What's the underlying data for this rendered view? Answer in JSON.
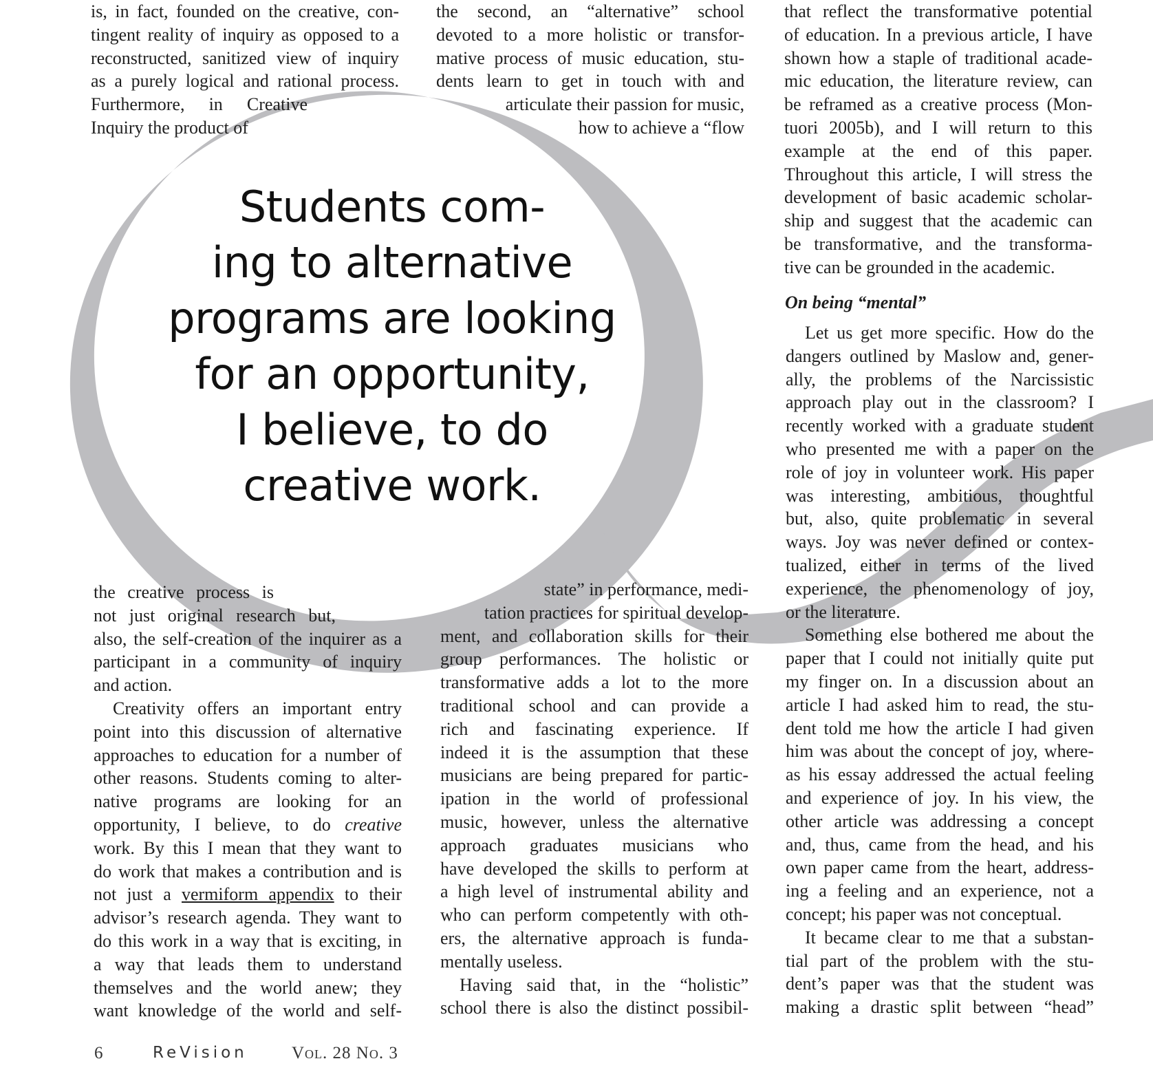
{
  "col1_top": [
    "is, in fact, founded on the creative, con-",
    "tingent reality of inquiry as opposed to a",
    "reconstructed, sanitized view of inquiry",
    "as a purely logical and rational process.",
    "Furthermore,  in  Creative",
    "Inquiry the product of"
  ],
  "col2_top": [
    "the second, an “alternative” school",
    "devoted to a more holistic or transfor-",
    "mative process of music education, stu-",
    "dents learn to get in touch with and",
    "articulate their passion for music,",
    "how to achieve a “flow"
  ],
  "col3": {
    "para1": [
      "that reflect the transformative potential",
      "of education. In a previous article, I have",
      "shown how a staple of traditional acade-",
      "mic education, the literature review, can",
      "be reframed as a creative process (Mon-",
      "tuori 2005b), and I will return to this",
      "example at the end of this paper.",
      "Throughout this article, I will stress the",
      "development of basic academic scholar-",
      "ship and suggest that the academic can",
      "be transformative, and the transforma-",
      "tive can be grounded in the academic."
    ],
    "heading": "On being “mental”",
    "para2": [
      "Let us get more specific. How do the",
      "dangers outlined by Maslow and, gener-",
      "ally, the problems of the Narcissistic",
      "approach play out in the classroom? I",
      "recently worked with a graduate student",
      "who presented me with a paper on the",
      "role of joy in volunteer work. His paper",
      "was interesting, ambitious, thoughtful",
      "but, also, quite problematic in several",
      "ways. Joy was never defined or contex-",
      "tualized, either in terms of the lived",
      "experience, the phenomenology of joy,",
      "or the literature."
    ],
    "para3": [
      "Something else bothered me about the",
      "paper that I could not initially quite put",
      "my finger on. In a discussion about an",
      "article I had asked him to read, the stu-",
      "dent told me how the article I had given",
      "him was about the concept of joy, where-",
      "as his essay addressed the actual feeling",
      "and experience of joy. In his view, the",
      "other article was addressing a concept",
      "and, thus, came from the head, and his",
      "own paper came from the heart, address-",
      "ing a feeling and an experience, not a",
      "concept; his paper was not conceptual."
    ],
    "para4": [
      "It became clear to me that a substan-",
      "tial part of the problem with the stu-",
      "dent’s paper was that the student was",
      "making a drastic split between “head”"
    ]
  },
  "col1_bottom": {
    "para1": [
      "the creative process is",
      "not just original research but,",
      "also, the self-creation of the inquirer as a",
      "participant in a community of inquiry",
      "and action."
    ],
    "para2": {
      "l1": "Creativity offers an important entry",
      "l2": "point into this discussion of alternative",
      "l3": "approaches to education for a number of",
      "l4": "other reasons. Students coming to alter-",
      "l5": "native programs are looking for an",
      "l6a": "opportunity, I believe, to do ",
      "l6b": "creative",
      "l7": "work. By this I mean that they want to",
      "l8": "do work that makes a contribution and is",
      "l9a": "not just a ",
      "l9b": "vermiform appendix",
      "l9c": " to their",
      "l10": "advisor’s research agenda. They want to",
      "l11": "do this work in a way that is exciting, in",
      "l12": "a way that leads them to understand",
      "l13": "themselves and the world anew; they",
      "l14": "want knowledge of the world and self-"
    }
  },
  "col2_bottom": {
    "para1": [
      "state” in performance, medi-",
      "tation practices for spiritual develop-",
      "ment, and collaboration skills for their",
      "group performances. The holistic or",
      "transformative adds a lot to the more",
      "traditional school and can provide a",
      "rich and fascinating experience. If",
      "indeed it is the assumption that these",
      "musicians are being prepared for partic-",
      "ipation in the world of professional",
      "music, however, unless the alternative",
      "approach graduates musicians who",
      "have developed the skills to perform at",
      "a high level of instrumental ability and",
      "who can perform competently with oth-",
      "ers, the alternative approach is funda-",
      "mentally useless."
    ],
    "para2": [
      "Having said that, in the “holistic”",
      "school there is also the distinct possibil-"
    ]
  },
  "pull_quote": [
    "Students com-",
    "ing to alternative",
    "programs are looking",
    "for an opportunity,",
    "I believe, to do",
    "creative work."
  ],
  "footer": {
    "page_number": "6",
    "journal": "ReVision",
    "volume": "Vol. 28 No. 3"
  },
  "colors": {
    "q_gray": "#bdbdc0",
    "text": "#1f1f1f"
  }
}
